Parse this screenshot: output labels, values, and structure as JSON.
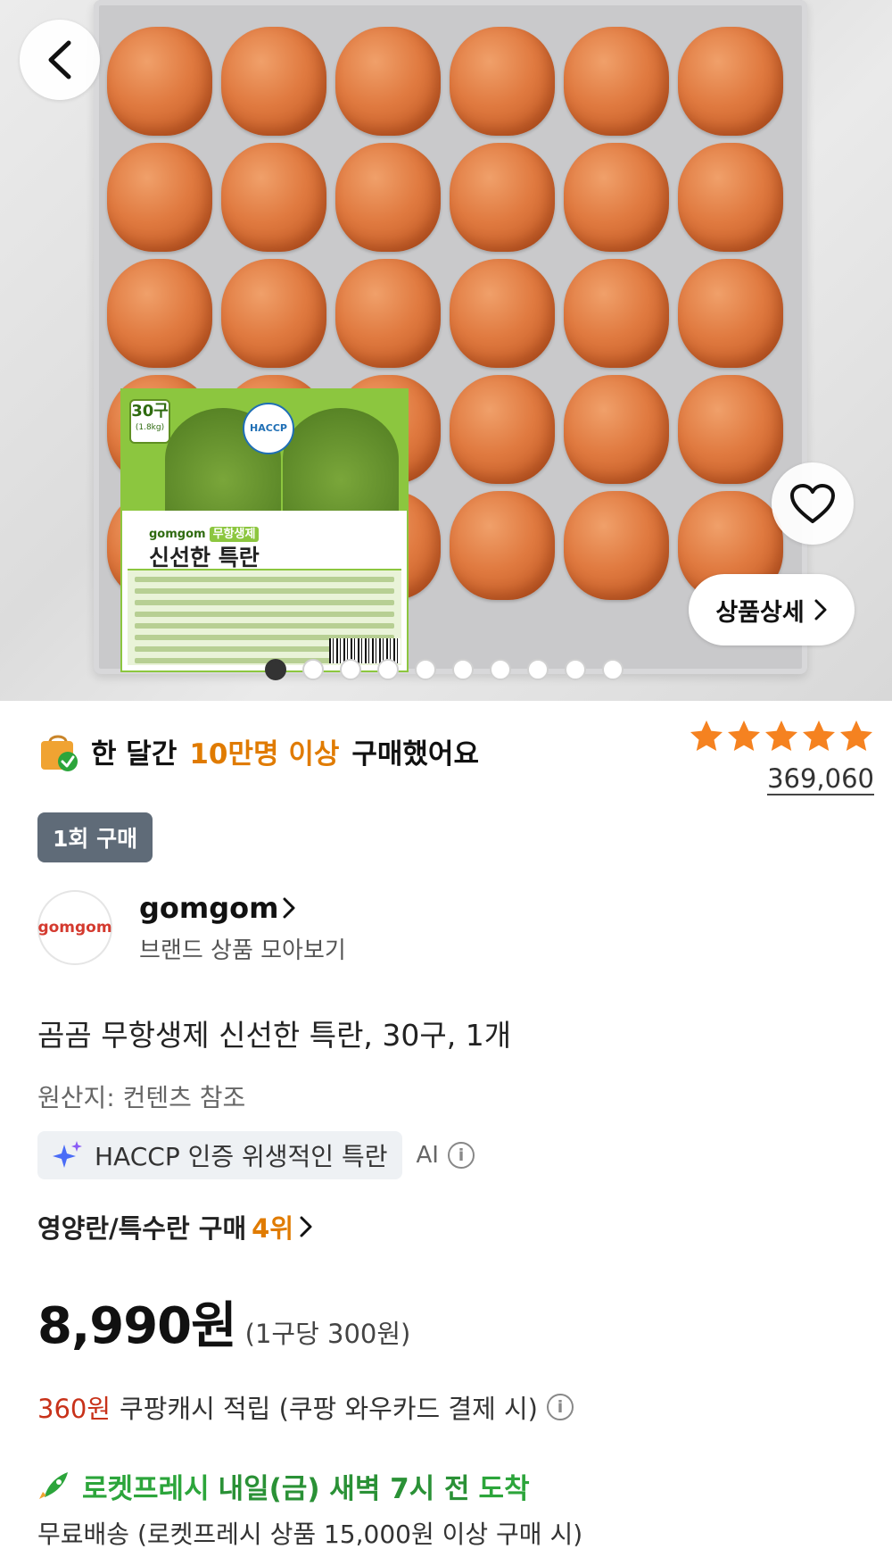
{
  "hero": {
    "label_count": "30구",
    "label_weight": "(1.8kg)",
    "label_haccp": "HACCP",
    "label_brand": "gomgom",
    "label_brand_tag": "무항생제",
    "label_product": "신선한 특란",
    "detail_button": "상품상세",
    "total_slides": 10,
    "active_slide": 1
  },
  "badge": {
    "prefix": "한 달간",
    "highlight": "10만명 이상",
    "suffix": "구매했어요"
  },
  "rating": {
    "stars": 5,
    "review_count": "369,060",
    "star_color": "#f58220"
  },
  "purchase_chip": "1회 구매",
  "brand": {
    "name": "gomgom",
    "subtitle": "브랜드 상품 모아보기",
    "logo_text": "gomgom"
  },
  "product": {
    "title": "곰곰 무항생제 신선한 특란, 30구, 1개",
    "origin": "원산지: 컨텐츠 참조"
  },
  "ai_summary": {
    "text": "HACCP 인증 위생적인 특란",
    "label": "AI"
  },
  "ranking": {
    "category": "영양란/특수란 구매",
    "rank": "4위"
  },
  "price": {
    "amount": "8,990원",
    "unit_price": "(1구당 300원)"
  },
  "cashback": {
    "amount": "360원",
    "text": "쿠팡캐시 적립 (쿠팡 와우카드 결제 시)"
  },
  "delivery": {
    "service": "로켓프레시",
    "time": "내일(금) 새벽 7시 전",
    "arrival": "도착",
    "shipping_note": "무료배송 (로켓프레시 상품 15,000원 이상 구매 시)"
  },
  "colors": {
    "accent_orange": "#e07b00",
    "cash_red": "#c8321a",
    "rocket_green": "#2ca53b"
  }
}
